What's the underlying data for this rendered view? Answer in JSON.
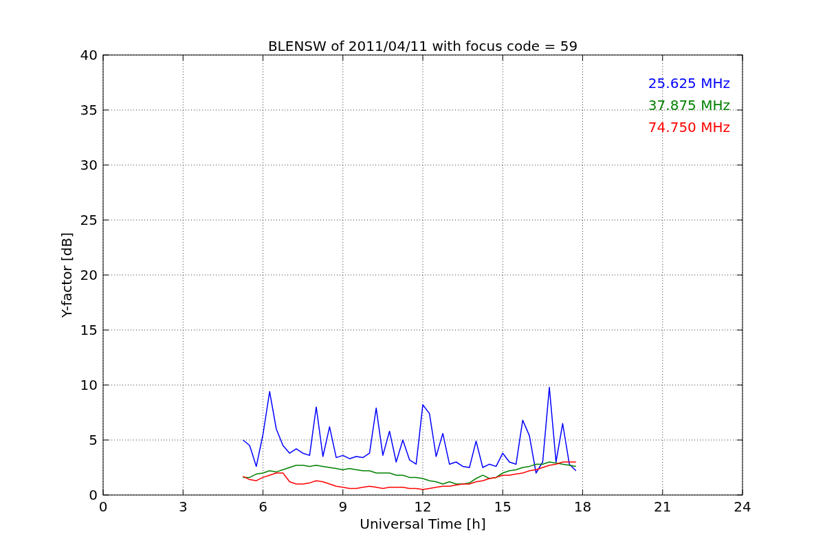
{
  "figure": {
    "chart_data": {
      "type": "line",
      "title": "BLENSW of 2011/04/11 with focus code = 59",
      "xlabel": "Universal Time [h]",
      "ylabel": "Y-factor [dB]",
      "grid": true,
      "xlim": [
        0,
        24
      ],
      "ylim": [
        0,
        40
      ],
      "xticks": [
        0,
        3,
        6,
        9,
        12,
        15,
        18,
        21,
        24
      ],
      "yticks": [
        0,
        5,
        10,
        15,
        20,
        25,
        30,
        35,
        40
      ],
      "x": [
        5.25,
        5.5,
        5.75,
        6,
        6.25,
        6.5,
        6.75,
        7,
        7.25,
        7.5,
        7.75,
        8,
        8.25,
        8.5,
        8.75,
        9,
        9.25,
        9.5,
        9.75,
        10,
        10.25,
        10.5,
        10.75,
        11,
        11.25,
        11.5,
        11.75,
        12,
        12.25,
        12.5,
        12.75,
        13,
        13.25,
        13.5,
        13.75,
        14,
        14.25,
        14.5,
        14.75,
        15,
        15.25,
        15.5,
        15.75,
        16,
        16.25,
        16.5,
        16.75,
        17,
        17.25,
        17.5,
        17.75
      ],
      "series": [
        {
          "name": "25.625 MHz",
          "color": "#0000ff",
          "values": [
            5.0,
            4.5,
            2.6,
            5.5,
            9.4,
            6.0,
            4.5,
            3.8,
            4.2,
            3.8,
            3.6,
            8.0,
            3.5,
            6.2,
            3.4,
            3.6,
            3.3,
            3.5,
            3.4,
            3.8,
            7.9,
            3.6,
            5.8,
            3.0,
            5.0,
            3.2,
            2.8,
            8.2,
            7.4,
            3.5,
            5.6,
            2.8,
            3.0,
            2.6,
            2.5,
            4.9,
            2.5,
            2.8,
            2.6,
            3.8,
            3.0,
            2.8,
            6.8,
            5.4,
            2.0,
            3.0,
            9.8,
            3.0,
            6.5,
            2.8,
            2.2
          ]
        },
        {
          "name": "37.875 MHz",
          "color": "#008000",
          "values": [
            1.6,
            1.6,
            1.9,
            2.0,
            2.2,
            2.1,
            2.3,
            2.5,
            2.7,
            2.7,
            2.6,
            2.7,
            2.6,
            2.5,
            2.4,
            2.3,
            2.4,
            2.3,
            2.2,
            2.2,
            2.0,
            2.0,
            2.0,
            1.8,
            1.8,
            1.6,
            1.6,
            1.5,
            1.3,
            1.2,
            1.0,
            1.2,
            1.0,
            1.0,
            1.1,
            1.5,
            1.8,
            1.5,
            1.6,
            2.0,
            2.2,
            2.3,
            2.5,
            2.6,
            2.8,
            2.8,
            3.0,
            2.9,
            2.8,
            2.7,
            2.6
          ]
        },
        {
          "name": "74.750 MHz",
          "color": "#ff0000",
          "values": [
            1.7,
            1.4,
            1.3,
            1.6,
            1.8,
            2.0,
            2.0,
            1.2,
            1.0,
            1.0,
            1.1,
            1.3,
            1.2,
            1.0,
            0.8,
            0.7,
            0.6,
            0.6,
            0.7,
            0.8,
            0.7,
            0.6,
            0.7,
            0.7,
            0.7,
            0.6,
            0.6,
            0.5,
            0.6,
            0.7,
            0.8,
            0.8,
            0.9,
            1.0,
            1.0,
            1.2,
            1.3,
            1.5,
            1.6,
            1.8,
            1.8,
            1.9,
            2.0,
            2.2,
            2.3,
            2.5,
            2.7,
            2.8,
            3.0,
            3.0,
            3.0
          ]
        }
      ]
    }
  }
}
